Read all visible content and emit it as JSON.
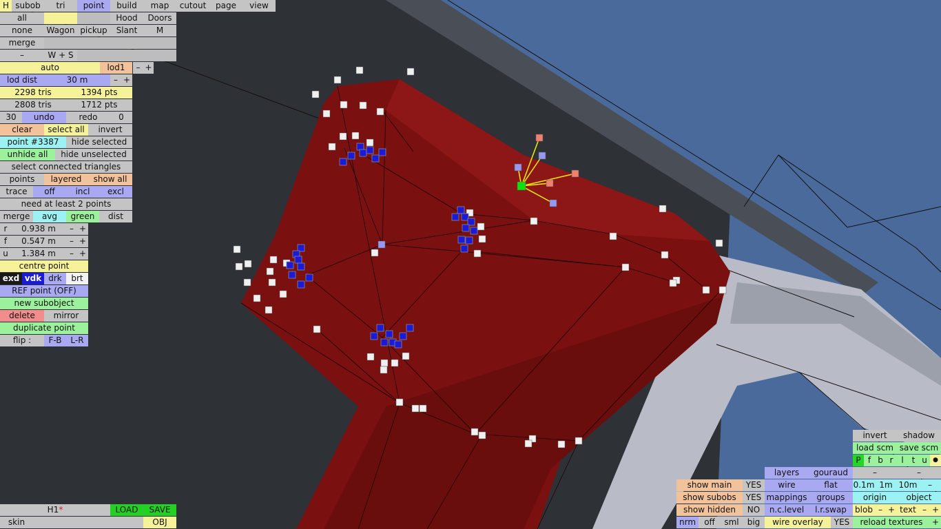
{
  "viewport": {
    "sky_color": "#4a6a9c",
    "dark_surface_color": "#2e3136",
    "mesh_color": "#7a1010",
    "light_surface_color": "#b9bcc6"
  },
  "top_tabs": [
    "H",
    "subob",
    "tri",
    "point",
    "build",
    "map",
    "cutout",
    "page",
    "view"
  ],
  "row_all": {
    "all": "all",
    "hood": "Hood",
    "doors": "Doors"
  },
  "row_none": {
    "none": "none",
    "wagon": "Wagon",
    "pickup": "pickup",
    "slant": "Slant",
    "m": "M"
  },
  "row_merge": {
    "merge": "merge"
  },
  "row_dash": {
    "dash": "–",
    "ws": "W + S"
  },
  "lod": {
    "auto": "auto",
    "lod1": "lod1",
    "minus": "–",
    "plus": "+",
    "dist_label": "lod dist",
    "dist_value": "30 m"
  },
  "stats": {
    "tris1": "2298 tris",
    "pts1": "1394 pts",
    "tris2": "2808 tris",
    "pts2": "1712 pts"
  },
  "undo_row": {
    "count": "30",
    "undo": "undo",
    "redo": "redo",
    "redo_count": "0"
  },
  "select": {
    "clear": "clear",
    "select_all": "select all",
    "invert": "invert",
    "point": "point #3387",
    "hide_selected": "hide selected",
    "unhide_all": "unhide all",
    "hide_unselected": "hide unselected",
    "connected": "select connected triangles"
  },
  "points_row": {
    "points": "points",
    "layered": "layered",
    "show_all": "show all"
  },
  "trace_row": {
    "trace": "trace",
    "off": "off",
    "incl": "incl",
    "excl": "excl"
  },
  "need": "need at least 2 points",
  "merge_row": {
    "merge": "merge",
    "avg": "avg",
    "green": "green",
    "dist": "dist"
  },
  "coords": [
    {
      "axis": "r",
      "value": "0.938 m"
    },
    {
      "axis": "f",
      "value": "0.547 m"
    },
    {
      "axis": "u",
      "value": "1.384 m"
    }
  ],
  "centre_point": "centre point",
  "shade_row": {
    "exd": "exd",
    "vdk": "vdk",
    "drk": "drk",
    "brt": "brt"
  },
  "actions": {
    "ref": "REF point (OFF)",
    "new_subobject": "new subobject",
    "delete": "delete",
    "mirror": "mirror",
    "duplicate": "duplicate point",
    "flip": "flip :",
    "fb": "F-B",
    "lr": "L-R"
  },
  "bottom_left": {
    "file": "H1",
    "star": "*",
    "load": "LOAD",
    "save": "SAVE",
    "skin": "skin",
    "obj": "OBJ"
  },
  "bottom_right": {
    "invert": "invert",
    "shadow": "shadow",
    "load_scm": "load scm",
    "save_scm": "save scm",
    "pfbrltu": [
      "P",
      "f",
      "b",
      "r",
      "l",
      "t",
      "u"
    ],
    "dot": "●",
    "layers": "layers",
    "gouraud": "gouraud",
    "show_main": "show main",
    "show_main_v": "YES",
    "wire": "wire",
    "flat": "flat",
    "d01": "0.1m",
    "d1": "1m",
    "d10": "10m",
    "show_subobs": "show subobs",
    "show_subobs_v": "YES",
    "mappings": "mappings",
    "groups": "groups",
    "origin": "origin",
    "object": "object",
    "show_hidden": "show hidden",
    "show_hidden_v": "NO",
    "nclevel": "n.c.level",
    "lrswap": "l.r.swap",
    "blob": "blob",
    "text": "text",
    "nrm": "nrm",
    "off": "off",
    "sml": "sml",
    "big": "big",
    "wire_overlay": "wire overlay",
    "wire_overlay_v": "YES",
    "reload": "reload textures"
  }
}
